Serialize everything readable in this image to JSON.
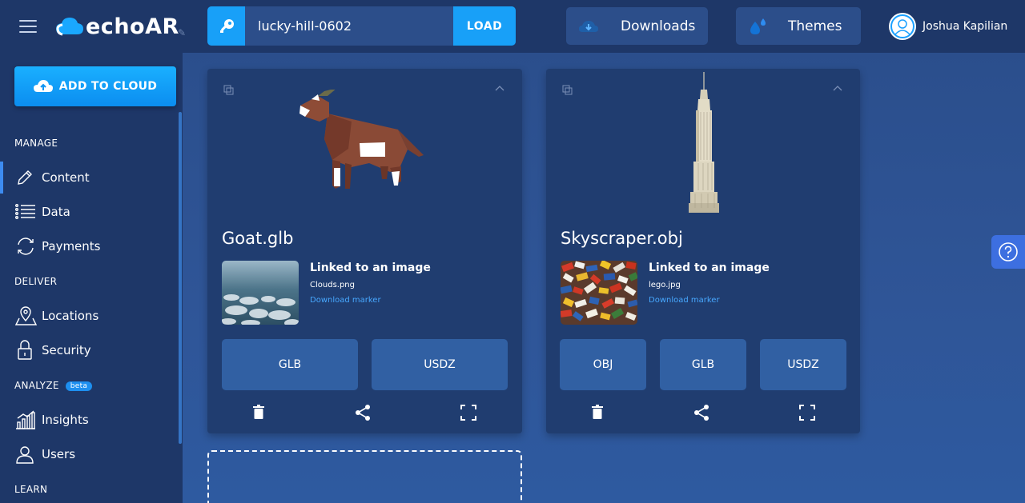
{
  "header": {
    "app_name": "echoAR",
    "api_key_value": "lucky-hill-0602",
    "load_label": "LOAD",
    "downloads_label": "Downloads",
    "themes_label": "Themes",
    "user_name": "Joshua Kapilian"
  },
  "sidebar": {
    "add_to_cloud_label": "ADD TO CLOUD",
    "sections": {
      "manage": "MANAGE",
      "deliver": "DELIVER",
      "analyze": "ANALYZE",
      "analyze_badge": "beta",
      "learn": "LEARN"
    },
    "items": {
      "content": "Content",
      "data": "Data",
      "payments": "Payments",
      "locations": "Locations",
      "security": "Security",
      "insights": "Insights",
      "users": "Users"
    },
    "active_item": "content"
  },
  "cards": [
    {
      "title": "Goat.glb",
      "linked_label": "Linked to an image",
      "image_name": "Clouds.png",
      "download_marker_label": "Download marker",
      "formats": [
        "GLB",
        "USDZ"
      ]
    },
    {
      "title": "Skyscraper.obj",
      "linked_label": "Linked to an image",
      "image_name": "lego.jpg",
      "download_marker_label": "Download marker",
      "formats": [
        "OBJ",
        "GLB",
        "USDZ"
      ]
    }
  ],
  "colors": {
    "accent": "#18a0f8",
    "panel": "#203d70",
    "topbar": "#1e3768",
    "link": "#47a8ff"
  }
}
